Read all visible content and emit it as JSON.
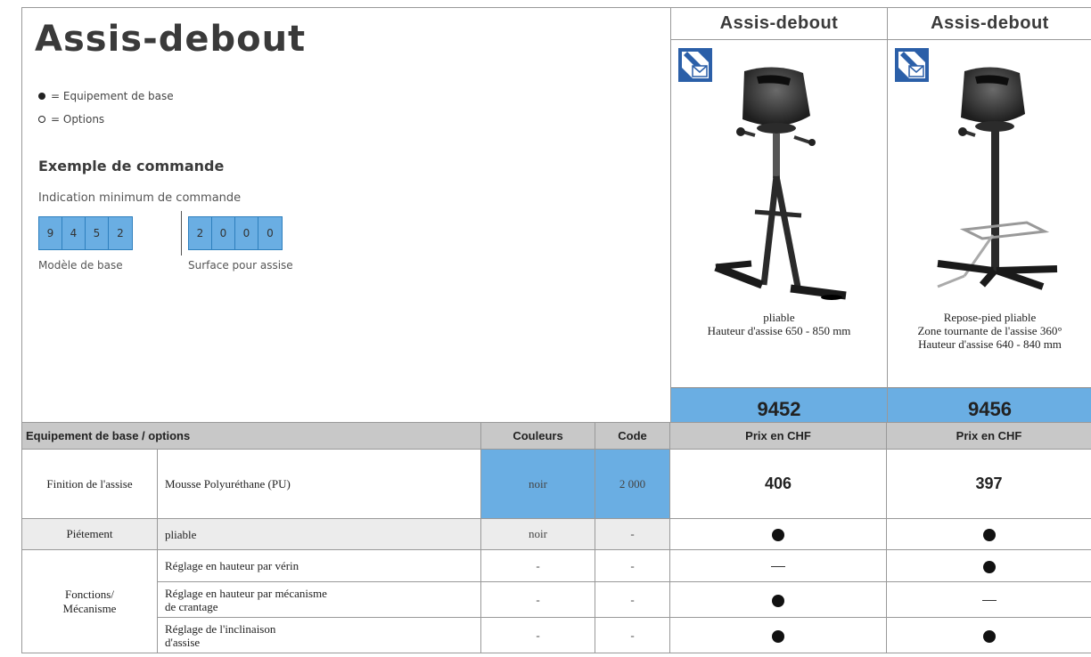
{
  "title": "Assis-debout",
  "legend": [
    {
      "symbol": "filled",
      "text": "= Equipement de base"
    },
    {
      "symbol": "open",
      "text": "= Options"
    }
  ],
  "order_example": {
    "title": "Exemple de commande",
    "subtitle": "Indication minimum de commande",
    "base_digits": [
      "9",
      "4",
      "5",
      "2"
    ],
    "surface_digits": [
      "2",
      "0",
      "0",
      "0"
    ],
    "base_label": "Modèle de base",
    "surface_label": "Surface pour assise"
  },
  "products": [
    {
      "header": "Assis-debout",
      "icon": "delivery-mail-icon",
      "image": "folding-standing-chair",
      "desc_lines": [
        "pliable",
        "Hauteur d'assise   650 - 850 mm"
      ],
      "number": "9452"
    },
    {
      "header": "Assis-debout",
      "icon": "delivery-mail-icon",
      "image": "standing-chair-with-footrest",
      "desc_lines": [
        "Repose-pied pliable",
        "Zone tournante de l'assise 360°",
        "Hauteur d'assise   640 - 840 mm"
      ],
      "number": "9456"
    }
  ],
  "table": {
    "headers": {
      "equipment": "Equipement de base / options",
      "colors": "Couleurs",
      "code": "Code",
      "price1": "Prix en CHF",
      "price2": "Prix en CHF"
    },
    "rows": [
      {
        "category": "Finition de l'assise",
        "feature": "Mousse  Polyuréthane  (PU)",
        "color": "noir",
        "code": "2 000",
        "p1": "406",
        "p2": "397"
      },
      {
        "category": "Piétement",
        "feature": "pliable",
        "color": "noir",
        "code": "-",
        "p1": "dot",
        "p2": "dot"
      },
      {
        "category": "Fonctions/\nMécanisme",
        "feature": "Réglage en hauteur par vérin",
        "color": "-",
        "code": "-",
        "p1": "dash",
        "p2": "dot"
      },
      {
        "feature": "Réglage  en hauteur  par  mécanisme\nde crantage",
        "color": "-",
        "code": "-",
        "p1": "dot",
        "p2": "dash"
      },
      {
        "feature": "Réglage  de l'inclinaison\nd'assise",
        "color": "-",
        "code": "-",
        "p1": "dot",
        "p2": "dot"
      }
    ]
  }
}
